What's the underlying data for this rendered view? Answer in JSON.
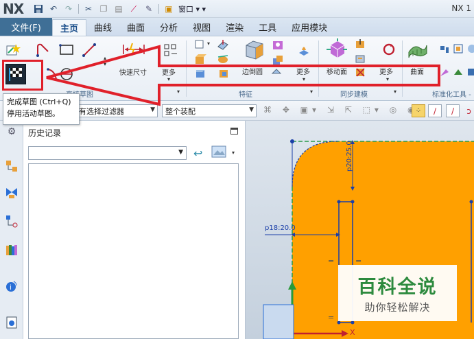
{
  "app": {
    "logo": "NX",
    "title_short": "NX 1"
  },
  "quick_access": {
    "window_menu": "窗口"
  },
  "tabs": {
    "file": "文件(F)",
    "items": [
      "主页",
      "曲线",
      "曲面",
      "分析",
      "视图",
      "渲染",
      "工具",
      "应用模块"
    ],
    "active_index": 0
  },
  "ribbon": {
    "quick_dimension": "快速尺寸",
    "more": "更多",
    "edge_blend": "边倒圆",
    "more2": "更多",
    "move_face": "移动面",
    "more3": "更多",
    "surface": "曲面",
    "groups": {
      "direct_sketch": "直接草图",
      "feature": "特征",
      "sync_modeling": "同步建模",
      "standard_tools": "标准化工具 -"
    }
  },
  "tooltip": {
    "line1": "完成草图 (Ctrl+Q)",
    "line2": "停用活动草图。"
  },
  "filterbar": {
    "selection_filter": "有选择过滤器",
    "assembly_scope": "整个装配"
  },
  "history_panel": {
    "title": "历史记录"
  },
  "graphics": {
    "dim_vertical": "p20:25.0",
    "dim_horizontal": "p18:20.0",
    "axis_x": "X"
  },
  "watermark": {
    "title": "百科全说",
    "subtitle": "助你轻松解决"
  },
  "colors": {
    "accent_red": "#e0202a",
    "file_tab": "#3f6f96",
    "part_orange": "#ffa000",
    "sketch_dim": "#1a3fa8"
  }
}
